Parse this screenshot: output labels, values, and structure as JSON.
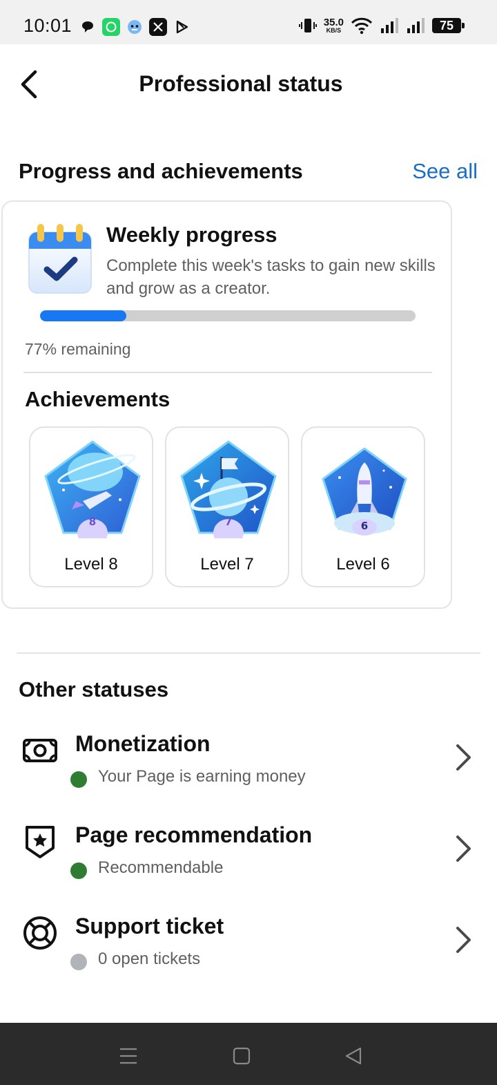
{
  "status_bar": {
    "time": "10:01",
    "notification_icons": [
      "chat-bubble-icon",
      "whatsapp-icon",
      "bot-face-icon",
      "x-icon",
      "play-store-icon"
    ],
    "net_speed_value": "35.0",
    "net_speed_unit": "KB/S",
    "battery": "75"
  },
  "header": {
    "title": "Professional status",
    "back_icon": "chevron-left-icon"
  },
  "progress_section": {
    "title": "Progress and achievements",
    "see_all_label": "See all",
    "weekly": {
      "title": "Weekly progress",
      "description": "Complete this week's tasks to gain new skills and grow as a creator.",
      "progress_fraction": 0.23,
      "remaining_text": "77% remaining"
    },
    "achievements": {
      "title": "Achievements",
      "badges": [
        {
          "label": "Level 8",
          "number": "8"
        },
        {
          "label": "Level 7",
          "number": "7"
        },
        {
          "label": "Level 6",
          "number": "6"
        }
      ]
    }
  },
  "other_statuses": {
    "title": "Other statuses",
    "items": [
      {
        "title": "Monetization",
        "subtitle": "Your Page is earning money",
        "status_color": "#2e7d32",
        "icon": "money-icon"
      },
      {
        "title": "Page recommendation",
        "subtitle": "Recommendable",
        "status_color": "#2e7d32",
        "icon": "shield-star-icon"
      },
      {
        "title": "Support ticket",
        "subtitle": "0 open tickets",
        "status_color": "#b0b3b8",
        "icon": "lifebuoy-icon"
      }
    ]
  },
  "nav_bar": {
    "buttons": [
      "menu-icon",
      "home-square-icon",
      "back-triangle-icon"
    ]
  },
  "colors": {
    "accent": "#1877f2",
    "link": "#1a6fc4",
    "active_green": "#2e7d32",
    "inactive_gray": "#b0b3b8"
  }
}
